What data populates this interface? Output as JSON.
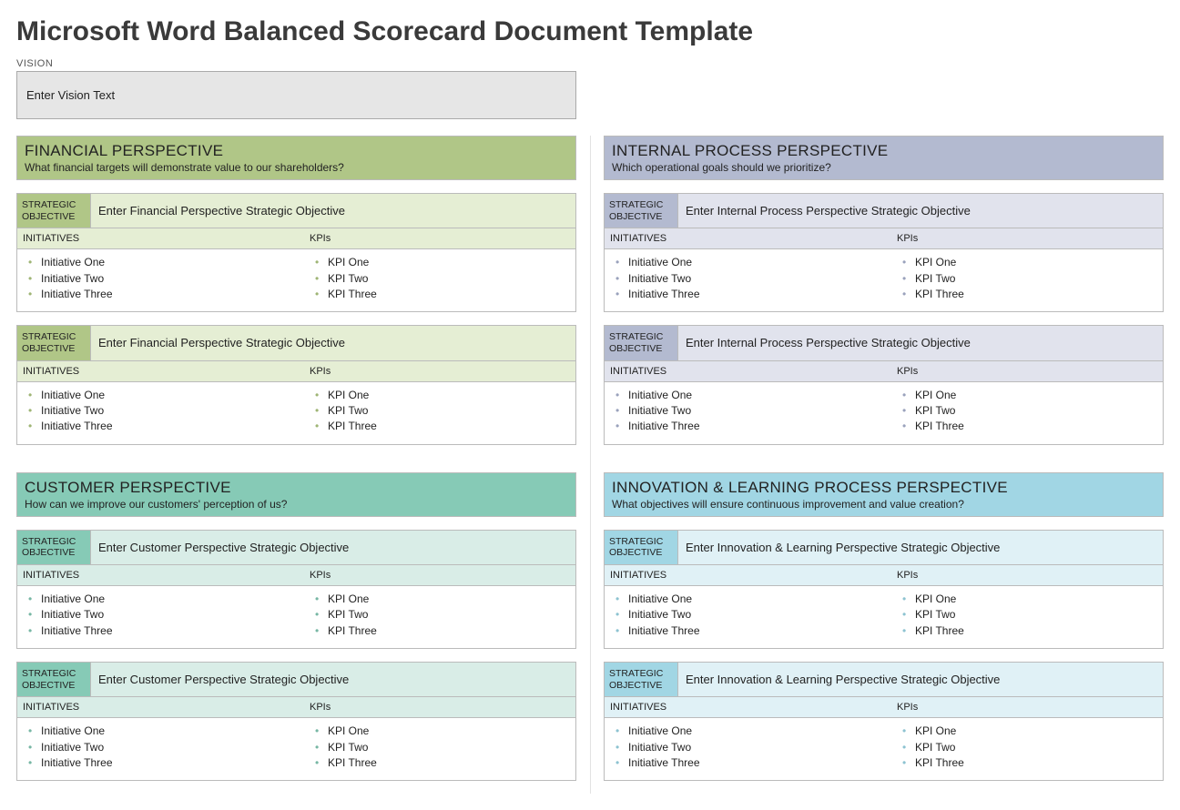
{
  "title": "Microsoft Word Balanced Scorecard Document Template",
  "vision_label": "VISION",
  "vision_value": "Enter Vision Text",
  "labels": {
    "strategic_objective": "STRATEGIC OBJECTIVE",
    "initiatives": "INITIATIVES",
    "kpis": "KPIs"
  },
  "perspectives": {
    "financial": {
      "title": "FINANCIAL PERSPECTIVE",
      "subtitle": "What financial targets will demonstrate value to our shareholders?",
      "objectives": [
        {
          "value": "Enter Financial Perspective Strategic Objective",
          "initiatives": [
            "Initiative One",
            "Initiative Two",
            "Initiative Three"
          ],
          "kpis": [
            "KPI One",
            "KPI Two",
            "KPI Three"
          ]
        },
        {
          "value": "Enter Financial Perspective Strategic Objective",
          "initiatives": [
            "Initiative One",
            "Initiative Two",
            "Initiative Three"
          ],
          "kpis": [
            "KPI One",
            "KPI Two",
            "KPI Three"
          ]
        }
      ]
    },
    "internal": {
      "title": "INTERNAL PROCESS PERSPECTIVE",
      "subtitle": "Which operational goals should we prioritize?",
      "objectives": [
        {
          "value": "Enter Internal Process Perspective Strategic Objective",
          "initiatives": [
            "Initiative One",
            "Initiative Two",
            "Initiative Three"
          ],
          "kpis": [
            "KPI One",
            "KPI Two",
            "KPI Three"
          ]
        },
        {
          "value": "Enter Internal Process Perspective Strategic Objective",
          "initiatives": [
            "Initiative One",
            "Initiative Two",
            "Initiative Three"
          ],
          "kpis": [
            "KPI One",
            "KPI Two",
            "KPI Three"
          ]
        }
      ]
    },
    "customer": {
      "title": "CUSTOMER PERSPECTIVE",
      "subtitle": "How can we improve our customers' perception of us?",
      "objectives": [
        {
          "value": "Enter Customer Perspective Strategic Objective",
          "initiatives": [
            "Initiative One",
            "Initiative Two",
            "Initiative Three"
          ],
          "kpis": [
            "KPI One",
            "KPI Two",
            "KPI Three"
          ]
        },
        {
          "value": "Enter Customer Perspective Strategic Objective",
          "initiatives": [
            "Initiative One",
            "Initiative Two",
            "Initiative Three"
          ],
          "kpis": [
            "KPI One",
            "KPI Two",
            "KPI Three"
          ]
        }
      ]
    },
    "innovation": {
      "title": "INNOVATION & LEARNING PROCESS PERSPECTIVE",
      "subtitle": "What objectives will ensure continuous improvement and value creation?",
      "objectives": [
        {
          "value": "Enter Innovation & Learning Perspective Strategic Objective",
          "initiatives": [
            "Initiative One",
            "Initiative Two",
            "Initiative Three"
          ],
          "kpis": [
            "KPI One",
            "KPI Two",
            "KPI Three"
          ]
        },
        {
          "value": "Enter Innovation & Learning Perspective Strategic Objective",
          "initiatives": [
            "Initiative One",
            "Initiative Two",
            "Initiative Three"
          ],
          "kpis": [
            "KPI One",
            "KPI Two",
            "KPI Three"
          ]
        }
      ]
    }
  }
}
